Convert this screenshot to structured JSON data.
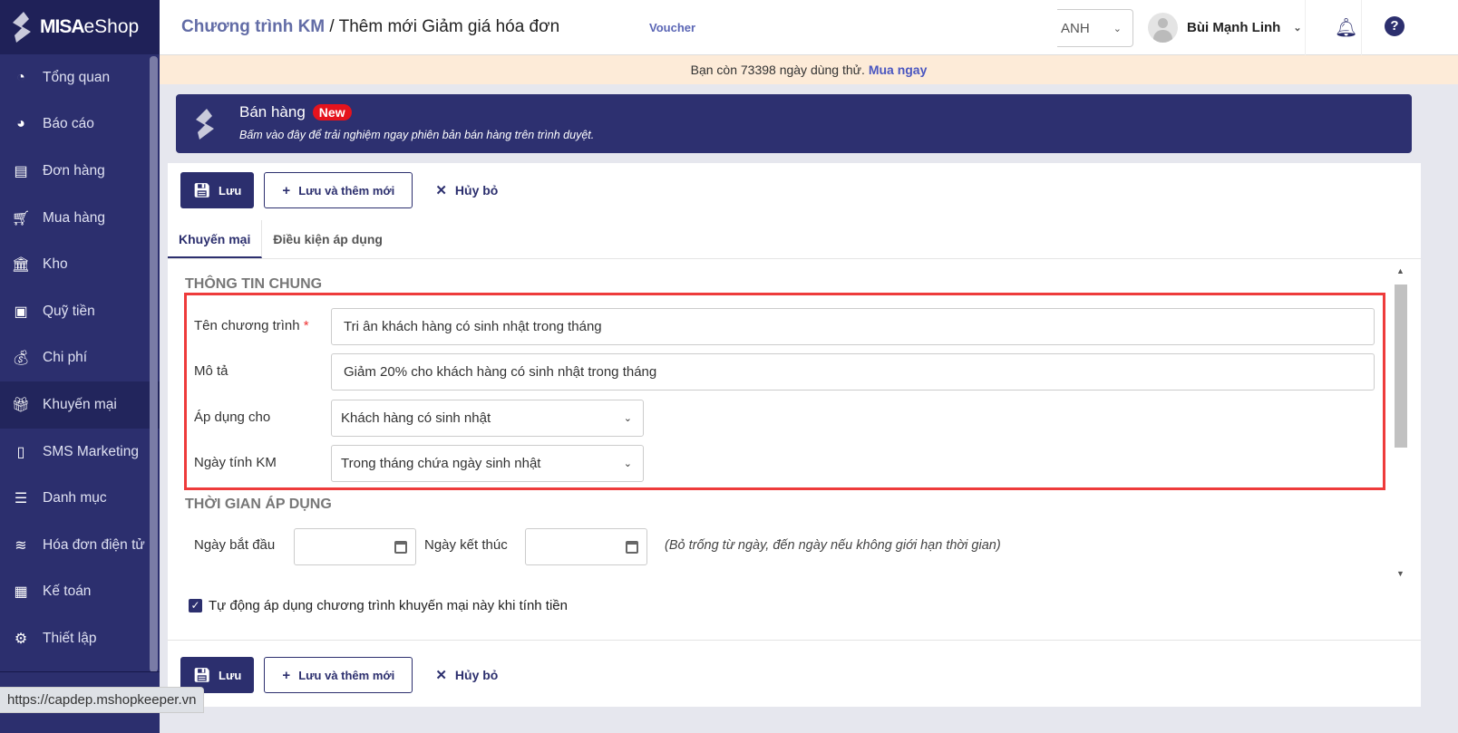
{
  "brand": {
    "logo_text_bold": "MISA",
    "logo_text": "eShop"
  },
  "sidebar": {
    "items": [
      {
        "label": "Tổng quan",
        "icon": "dashboard-icon"
      },
      {
        "label": "Báo cáo",
        "icon": "pie-chart-icon"
      },
      {
        "label": "Đơn hàng",
        "icon": "order-icon"
      },
      {
        "label": "Mua hàng",
        "icon": "cart-icon"
      },
      {
        "label": "Kho",
        "icon": "warehouse-icon"
      },
      {
        "label": "Quỹ tiền",
        "icon": "safe-icon"
      },
      {
        "label": "Chi phí",
        "icon": "money-icon"
      },
      {
        "label": "Khuyến mại",
        "icon": "gift-icon",
        "active": true
      },
      {
        "label": "SMS Marketing",
        "icon": "phone-icon"
      },
      {
        "label": "Danh mục",
        "icon": "list-icon"
      },
      {
        "label": "Hóa đơn điện tử",
        "icon": "invoice-icon"
      },
      {
        "label": "Kế toán",
        "icon": "calculator-icon"
      },
      {
        "label": "Thiết lập",
        "icon": "gear-icon"
      }
    ]
  },
  "header": {
    "breadcrumb_main": "Chương trình KM",
    "breadcrumb_sep": "/",
    "breadcrumb_current": "Thêm mới Giảm giá hóa đơn",
    "voucher_link": "Voucher",
    "branch": "ANH",
    "user_name": "Bùi Mạnh Linh"
  },
  "trial": {
    "text": "Bạn còn 73398 ngày dùng thử.",
    "link": "Mua ngay"
  },
  "promo": {
    "title": "Bán hàng",
    "badge": "New",
    "subtitle": "Bấm vào đây để trải nghiệm ngay phiên bản bán hàng trên trình duyệt."
  },
  "toolbar": {
    "save": "Lưu",
    "save_new": "Lưu và thêm mới",
    "cancel": "Hủy bỏ"
  },
  "tabs": [
    {
      "label": "Khuyến mại"
    },
    {
      "label": "Điều kiện áp dụng"
    }
  ],
  "general": {
    "heading": "THÔNG TIN CHUNG",
    "name_label": "Tên chương trình",
    "required": "*",
    "name_value": "Tri ân khách hàng có sinh nhật trong tháng",
    "desc_label": "Mô tả",
    "desc_value": "Giảm 20% cho khách hàng có sinh nhật trong tháng",
    "apply_label": "Áp dụng cho",
    "apply_value": "Khách hàng có sinh nhật",
    "date_label": "Ngày tính KM",
    "date_value": "Trong tháng chứa ngày sinh nhật"
  },
  "period": {
    "heading": "THỜI GIAN ÁP DỤNG",
    "start_label": "Ngày bắt đầu",
    "start_value": "",
    "end_label": "Ngày kết thúc",
    "end_value": "",
    "hint": "(Bỏ trống từ ngày, đến ngày nếu không giới hạn thời gian)"
  },
  "auto_apply": {
    "label": "Tự động áp dụng chương trình khuyến mại này khi tính tiền",
    "checked": true
  },
  "status_url": "https://capdep.mshopkeeper.vn"
}
